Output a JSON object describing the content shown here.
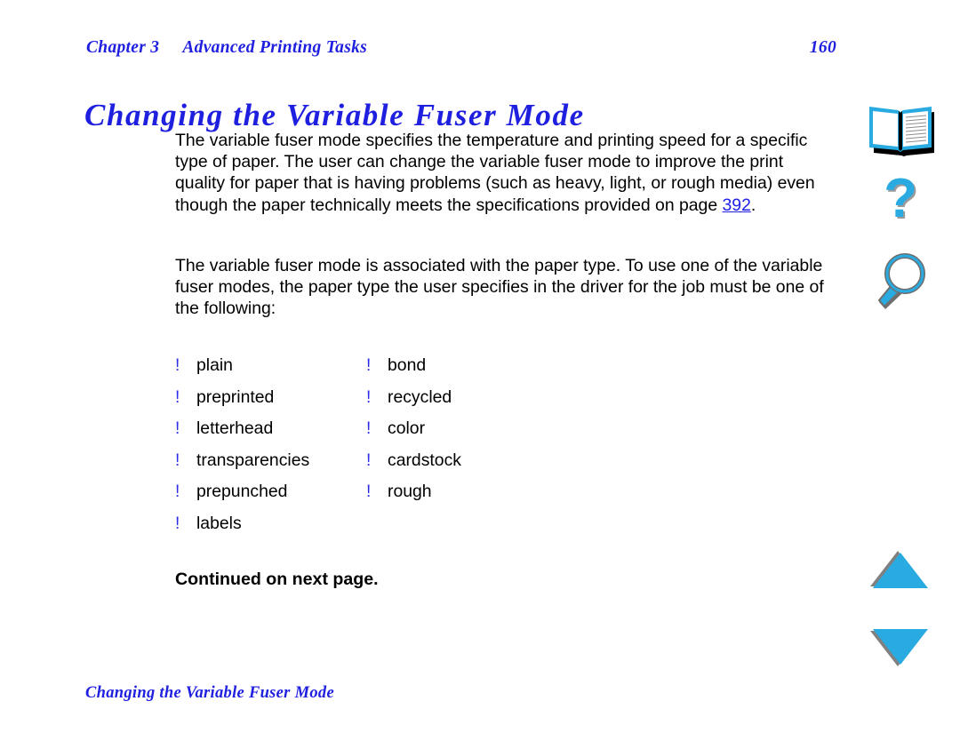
{
  "header": {
    "chapter": "Chapter 3",
    "section_title": "Advanced Printing Tasks",
    "page_number": "160"
  },
  "title": "Changing the Variable Fuser Mode",
  "paragraphs": {
    "p1_before_link": "The variable fuser mode specifies the temperature and printing speed for a specific type of paper. The user can change the variable fuser mode to improve the print quality for paper that is having problems (such as heavy, light, or rough media) even though the paper technically meets the specifications provided on page ",
    "p1_link": "392",
    "p1_after_link": ".",
    "p2": "The variable fuser mode is associated with the paper type. To use one of the variable fuser modes, the paper type the user specifies in the driver for the job must be one of the following:"
  },
  "list": {
    "bullet_glyph": "!",
    "rows": [
      {
        "left": "plain",
        "right": "bond"
      },
      {
        "left": "preprinted",
        "right": "recycled"
      },
      {
        "left": "letterhead",
        "right": "color"
      },
      {
        "left": "transparencies",
        "right": "cardstock"
      },
      {
        "left": "prepunched",
        "right": "rough"
      },
      {
        "left": "labels",
        "right": ""
      }
    ]
  },
  "continued_note": "Continued on next page.",
  "footer": {
    "title": "Changing the Variable Fuser Mode"
  },
  "icon_rail": {
    "items": [
      {
        "name": "book-icon",
        "label": "Contents"
      },
      {
        "name": "question-mark-icon",
        "label": "Help"
      },
      {
        "name": "magnifier-icon",
        "label": "Search"
      },
      {
        "name": "triangle-up-icon",
        "label": "Previous page"
      },
      {
        "name": "triangle-down-icon",
        "label": "Next page"
      }
    ]
  },
  "colors": {
    "heading_blue": "#1f1fe0",
    "link_blue": "#2020e8",
    "bullet_blue": "#2a2ae8",
    "icon_cyan": "#29abe2",
    "icon_shadow": "#808080",
    "body_black": "#000000",
    "page_background": "#ffffff"
  }
}
